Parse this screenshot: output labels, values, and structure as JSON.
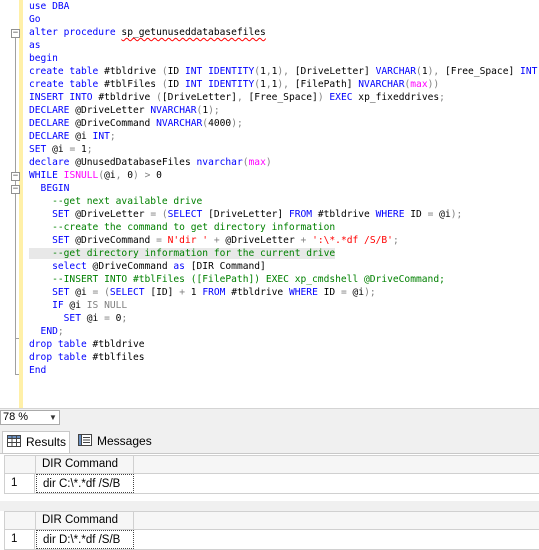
{
  "editor": {
    "lines": [
      [
        {
          "t": "use DBA",
          "c": "kw"
        }
      ],
      [
        {
          "t": "Go",
          "c": "kw"
        }
      ],
      [
        {
          "t": "alter procedure ",
          "c": "kw"
        },
        {
          "t": "sp_getunuseddatabasefiles",
          "c": "sq"
        }
      ],
      [
        {
          "t": "as",
          "c": "kw"
        }
      ],
      [
        {
          "t": "begin",
          "c": "kw"
        }
      ],
      [
        {
          "t": "create table",
          "c": "kw"
        },
        {
          "t": " #tbldrive ",
          "c": ""
        },
        {
          "t": "(",
          "c": "gy"
        },
        {
          "t": "ID ",
          "c": ""
        },
        {
          "t": "INT IDENTITY",
          "c": "kw"
        },
        {
          "t": "(",
          "c": "gy"
        },
        {
          "t": "1",
          "c": ""
        },
        {
          "t": ",",
          "c": "gy"
        },
        {
          "t": "1",
          "c": ""
        },
        {
          "t": "),",
          "c": "gy"
        },
        {
          "t": " [DriveLetter] ",
          "c": ""
        },
        {
          "t": "VARCHAR",
          "c": "kw"
        },
        {
          "t": "(",
          "c": "gy"
        },
        {
          "t": "1",
          "c": ""
        },
        {
          "t": "),",
          "c": "gy"
        },
        {
          "t": " [Free_Space] ",
          "c": ""
        },
        {
          "t": "INT",
          "c": "kw"
        },
        {
          "t": ")",
          "c": "gy"
        }
      ],
      [
        {
          "t": "create table",
          "c": "kw"
        },
        {
          "t": " #tblFiles ",
          "c": ""
        },
        {
          "t": "(",
          "c": "gy"
        },
        {
          "t": "ID ",
          "c": ""
        },
        {
          "t": "INT IDENTITY",
          "c": "kw"
        },
        {
          "t": "(",
          "c": "gy"
        },
        {
          "t": "1",
          "c": ""
        },
        {
          "t": ",",
          "c": "gy"
        },
        {
          "t": "1",
          "c": ""
        },
        {
          "t": "),",
          "c": "gy"
        },
        {
          "t": " [FilePath] ",
          "c": ""
        },
        {
          "t": "NVARCHAR",
          "c": "kw"
        },
        {
          "t": "(",
          "c": "gy"
        },
        {
          "t": "max",
          "c": "fn"
        },
        {
          "t": "))",
          "c": "gy"
        }
      ],
      [
        {
          "t": "INSERT INTO",
          "c": "kw"
        },
        {
          "t": " #tbldrive ",
          "c": ""
        },
        {
          "t": "(",
          "c": "gy"
        },
        {
          "t": "[DriveLetter]",
          "c": ""
        },
        {
          "t": ",",
          "c": "gy"
        },
        {
          "t": " [Free_Space]",
          "c": ""
        },
        {
          "t": ")",
          "c": "gy"
        },
        {
          "t": " EXEC",
          "c": "kw"
        },
        {
          "t": " xp_fixeddrives",
          "c": ""
        },
        {
          "t": ";",
          "c": "gy"
        }
      ],
      [
        {
          "t": "DECLARE",
          "c": "kw"
        },
        {
          "t": " @DriveLetter ",
          "c": ""
        },
        {
          "t": "NVARCHAR",
          "c": "kw"
        },
        {
          "t": "(",
          "c": "gy"
        },
        {
          "t": "1",
          "c": ""
        },
        {
          "t": ");",
          "c": "gy"
        }
      ],
      [
        {
          "t": "DECLARE",
          "c": "kw"
        },
        {
          "t": " @DriveCommand ",
          "c": ""
        },
        {
          "t": "NVARCHAR",
          "c": "kw"
        },
        {
          "t": "(",
          "c": "gy"
        },
        {
          "t": "4000",
          "c": ""
        },
        {
          "t": ");",
          "c": "gy"
        }
      ],
      [
        {
          "t": "DECLARE",
          "c": "kw"
        },
        {
          "t": " @i ",
          "c": ""
        },
        {
          "t": "INT",
          "c": "kw"
        },
        {
          "t": ";",
          "c": "gy"
        }
      ],
      [
        {
          "t": "SET",
          "c": "kw"
        },
        {
          "t": " @i ",
          "c": ""
        },
        {
          "t": "=",
          "c": "gy"
        },
        {
          "t": " 1",
          "c": ""
        },
        {
          "t": ";",
          "c": "gy"
        }
      ],
      [
        {
          "t": "declare",
          "c": "kw"
        },
        {
          "t": " @UnusedDatabaseFiles ",
          "c": ""
        },
        {
          "t": "nvarchar",
          "c": "kw"
        },
        {
          "t": "(",
          "c": "gy"
        },
        {
          "t": "max",
          "c": "fn"
        },
        {
          "t": ")",
          "c": "gy"
        }
      ],
      [
        {
          "t": "WHILE",
          "c": "kw"
        },
        {
          "t": " ",
          "c": ""
        },
        {
          "t": "ISNULL",
          "c": "fn"
        },
        {
          "t": "(",
          "c": "gy"
        },
        {
          "t": "@i",
          "c": ""
        },
        {
          "t": ",",
          "c": "gy"
        },
        {
          "t": " 0",
          "c": ""
        },
        {
          "t": ")",
          "c": "gy"
        },
        {
          "t": " >",
          "c": "gy"
        },
        {
          "t": " 0",
          "c": ""
        }
      ],
      [
        {
          "t": "  BEGIN",
          "c": "kw"
        }
      ],
      [
        {
          "t": "    --get next available drive",
          "c": "cm"
        }
      ],
      [
        {
          "t": "    SET",
          "c": "kw"
        },
        {
          "t": " @DriveLetter ",
          "c": ""
        },
        {
          "t": "=",
          "c": "gy"
        },
        {
          "t": " ",
          "c": ""
        },
        {
          "t": "(",
          "c": "gy"
        },
        {
          "t": "SELECT",
          "c": "kw"
        },
        {
          "t": " [DriveLetter] ",
          "c": ""
        },
        {
          "t": "FROM",
          "c": "kw"
        },
        {
          "t": " #tbldrive ",
          "c": ""
        },
        {
          "t": "WHERE",
          "c": "kw"
        },
        {
          "t": " ID ",
          "c": ""
        },
        {
          "t": "=",
          "c": "gy"
        },
        {
          "t": " @i",
          "c": ""
        },
        {
          "t": ");",
          "c": "gy"
        }
      ],
      [
        {
          "t": "    --create the command to get directory information",
          "c": "cm"
        }
      ],
      [
        {
          "t": "    SET",
          "c": "kw"
        },
        {
          "t": " @DriveCommand ",
          "c": ""
        },
        {
          "t": "=",
          "c": "gy"
        },
        {
          "t": " N'dir '",
          "c": "st"
        },
        {
          "t": " +",
          "c": "gy"
        },
        {
          "t": " @DriveLetter ",
          "c": ""
        },
        {
          "t": "+",
          "c": "gy"
        },
        {
          "t": " ':\\*.*df /S/B'",
          "c": "st"
        },
        {
          "t": ";",
          "c": "gy"
        }
      ],
      [
        {
          "t": "    --get directory information for the current drive",
          "c": "cm",
          "h": 1
        }
      ],
      [
        {
          "t": "    select",
          "c": "kw"
        },
        {
          "t": " @DriveCommand ",
          "c": ""
        },
        {
          "t": "as",
          "c": "kw"
        },
        {
          "t": " [DIR Command]",
          "c": ""
        }
      ],
      [
        {
          "t": "    --INSERT INTO #tblFiles ([FilePath]) EXEC xp_cmdshell @DriveCommand;",
          "c": "cm"
        }
      ],
      [
        {
          "t": "    SET",
          "c": "kw"
        },
        {
          "t": " @i ",
          "c": ""
        },
        {
          "t": "=",
          "c": "gy"
        },
        {
          "t": " ",
          "c": ""
        },
        {
          "t": "(",
          "c": "gy"
        },
        {
          "t": "SELECT",
          "c": "kw"
        },
        {
          "t": " [ID] ",
          "c": ""
        },
        {
          "t": "+",
          "c": "gy"
        },
        {
          "t": " 1 ",
          "c": ""
        },
        {
          "t": "FROM",
          "c": "kw"
        },
        {
          "t": " #tbldrive ",
          "c": ""
        },
        {
          "t": "WHERE",
          "c": "kw"
        },
        {
          "t": " ID ",
          "c": ""
        },
        {
          "t": "=",
          "c": "gy"
        },
        {
          "t": " @i",
          "c": ""
        },
        {
          "t": ");",
          "c": "gy"
        }
      ],
      [
        {
          "t": "    IF",
          "c": "kw"
        },
        {
          "t": " @i ",
          "c": ""
        },
        {
          "t": "IS NULL",
          "c": "gy"
        }
      ],
      [
        {
          "t": "      SET",
          "c": "kw"
        },
        {
          "t": " @i ",
          "c": ""
        },
        {
          "t": "=",
          "c": "gy"
        },
        {
          "t": " 0",
          "c": ""
        },
        {
          "t": ";",
          "c": "gy"
        }
      ],
      [
        {
          "t": "  END",
          "c": "kw"
        },
        {
          "t": ";",
          "c": "gy"
        }
      ],
      [
        {
          "t": "drop table",
          "c": "kw"
        },
        {
          "t": " #tbldrive",
          "c": ""
        }
      ],
      [
        {
          "t": "drop table",
          "c": "kw"
        },
        {
          "t": " #tblfiles",
          "c": ""
        }
      ],
      [
        {
          "t": "End",
          "c": "kw"
        }
      ]
    ]
  },
  "zoom": {
    "value": "78 %"
  },
  "tabs": {
    "results": "Results",
    "messages": "Messages"
  },
  "results": [
    {
      "column": "DIR Command",
      "rows": [
        {
          "n": "1",
          "value": "dir C:\\*.*df /S/B"
        }
      ]
    },
    {
      "column": "DIR Command",
      "rows": [
        {
          "n": "1",
          "value": "dir D:\\*.*df /S/B"
        }
      ]
    }
  ],
  "colors": {
    "keyword": "#0000ff",
    "function": "#ff00ff",
    "comment": "#008000",
    "string": "#ff0000",
    "operator": "#808080"
  }
}
